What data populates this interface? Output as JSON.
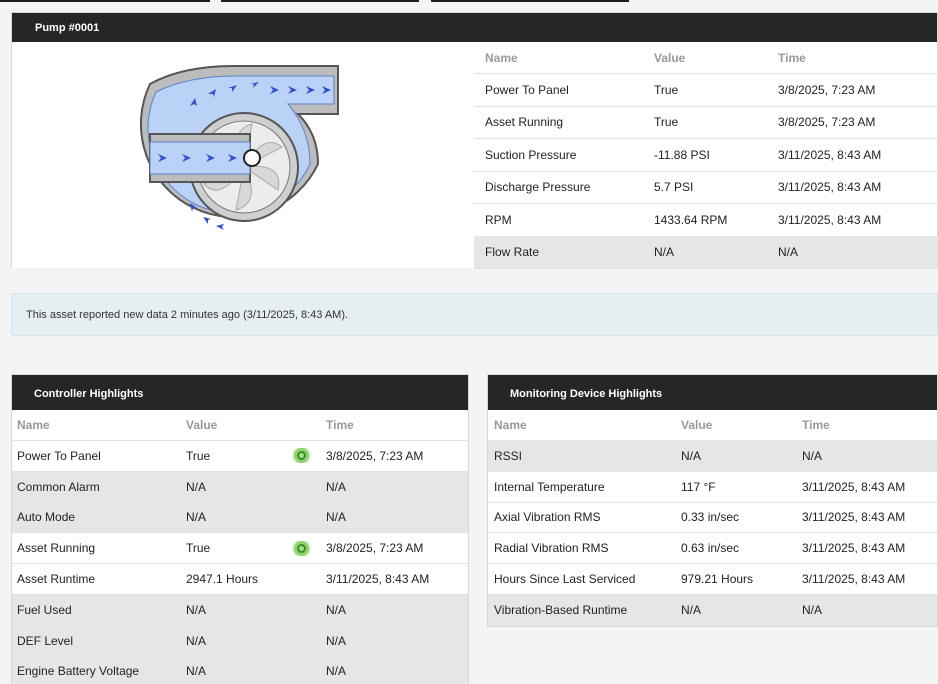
{
  "pump": {
    "title": "Pump #0001",
    "table": {
      "headers": [
        "Name",
        "Value",
        "Time"
      ],
      "rows": [
        {
          "name": "Power To Panel",
          "value": "True",
          "time": "3/8/2025, 7:23 AM"
        },
        {
          "name": "Asset Running",
          "value": "True",
          "time": "3/8/2025, 7:23 AM"
        },
        {
          "name": "Suction Pressure",
          "value": "-11.88 PSI",
          "time": "3/11/2025, 8:43 AM"
        },
        {
          "name": "Discharge Pressure",
          "value": "5.7 PSI",
          "time": "3/11/2025, 8:43 AM"
        },
        {
          "name": "RPM",
          "value": "1433.64 RPM",
          "time": "3/11/2025, 8:43 AM"
        },
        {
          "name": "Flow Rate",
          "value": "N/A",
          "time": "N/A"
        }
      ]
    }
  },
  "info_bar": {
    "text": "This asset reported new data 2 minutes ago (3/11/2025, 8:43 AM)."
  },
  "controller": {
    "title": "Controller Highlights",
    "headers": [
      "Name",
      "Value",
      "Time"
    ],
    "rows": [
      {
        "name": "Power To Panel",
        "value": "True",
        "time": "3/8/2025, 7:23 AM",
        "indicator": "green"
      },
      {
        "name": "Common Alarm",
        "value": "N/A",
        "time": "N/A"
      },
      {
        "name": "Auto Mode",
        "value": "N/A",
        "time": "N/A"
      },
      {
        "name": "Asset Running",
        "value": "True",
        "time": "3/8/2025, 7:23 AM",
        "indicator": "green"
      },
      {
        "name": "Asset Runtime",
        "value": "2947.1 Hours",
        "time": "3/11/2025, 8:43 AM"
      },
      {
        "name": "Fuel Used",
        "value": "N/A",
        "time": "N/A"
      },
      {
        "name": "DEF Level",
        "value": "N/A",
        "time": "N/A"
      },
      {
        "name": "Engine Battery Voltage",
        "value": "N/A",
        "time": "N/A"
      }
    ]
  },
  "monitoring": {
    "title": "Monitoring Device Highlights",
    "headers": [
      "Name",
      "Value",
      "Time"
    ],
    "rows": [
      {
        "name": "RSSI",
        "value": "N/A",
        "time": "N/A"
      },
      {
        "name": "Internal Temperature",
        "value": "117 °F",
        "time": "3/11/2025, 8:43 AM"
      },
      {
        "name": "Axial Vibration RMS",
        "value": "0.33 in/sec",
        "time": "3/11/2025, 8:43 AM"
      },
      {
        "name": "Radial Vibration RMS",
        "value": "0.63 in/sec",
        "time": "3/11/2025, 8:43 AM"
      },
      {
        "name": "Hours Since Last Serviced",
        "value": "979.21 Hours",
        "time": "3/11/2025, 8:43 AM"
      },
      {
        "name": "Vibration-Based Runtime",
        "value": "N/A",
        "time": "N/A"
      }
    ]
  },
  "colors": {
    "header_bg": "#262626",
    "status_green": "#8fd46d",
    "info_bg": "#e6eef2"
  },
  "icons": {
    "pump_diagram": "centrifugal-pump-icon",
    "status": "status-ok-icon"
  }
}
